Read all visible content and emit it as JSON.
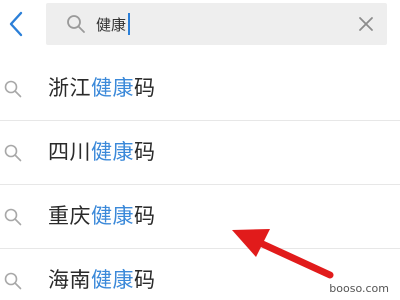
{
  "search": {
    "value": "健康"
  },
  "suggestions": [
    {
      "prefix": "浙江",
      "match": "健康",
      "suffix": "码"
    },
    {
      "prefix": "四川",
      "match": "健康",
      "suffix": "码"
    },
    {
      "prefix": "重庆",
      "match": "健康",
      "suffix": "码"
    },
    {
      "prefix": "海南",
      "match": "健康",
      "suffix": "码"
    }
  ],
  "icons": {
    "back": "chevron-left-icon",
    "search": "search-icon",
    "clear": "close-icon",
    "suggestion": "search-icon",
    "annotation": "arrow-icon"
  },
  "colors": {
    "accent": "#3b89d9",
    "searchBg": "#eeeeee",
    "arrow": "#e11b1b"
  },
  "watermark": "booso.com"
}
